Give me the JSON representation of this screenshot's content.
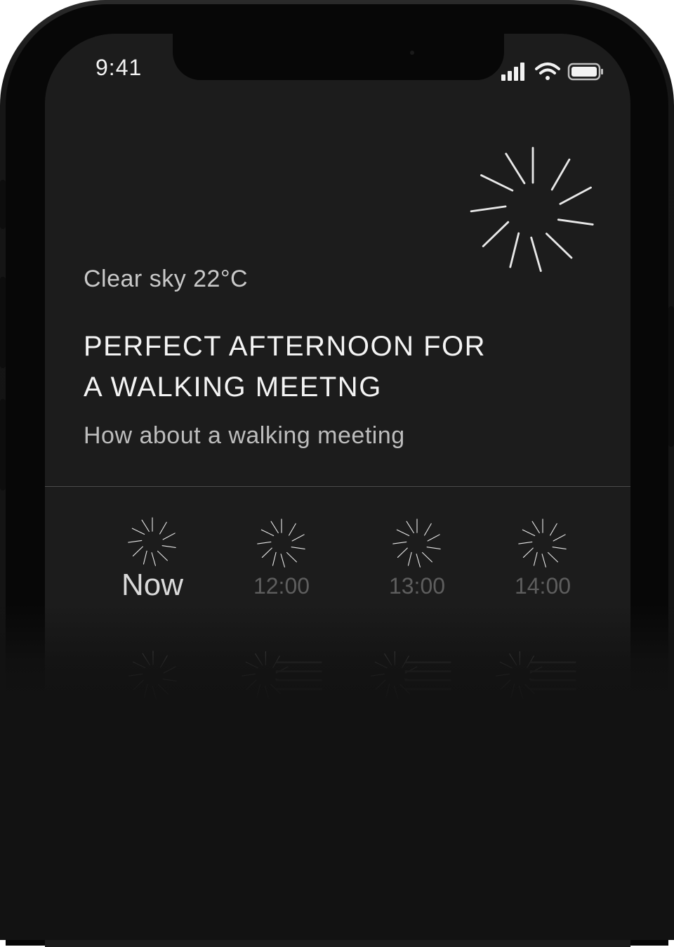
{
  "status_bar": {
    "time": "9:41"
  },
  "weather": {
    "condition": "Clear sky 22°C",
    "headline_line1": "PERFECT AFTERNOON FOR",
    "headline_line2": "A WALKING MEETNG",
    "subtitle": "How about a walking meeting",
    "icon": "clear-sky-sun-icon"
  },
  "forecast": {
    "hours": [
      {
        "label": "Now",
        "icon": "clear-sky-sun-icon"
      },
      {
        "label": "12:00",
        "icon": "clear-sky-sun-icon"
      },
      {
        "label": "13:00",
        "icon": "clear-sky-sun-icon"
      },
      {
        "label": "14:00",
        "icon": "clear-sky-sun-icon"
      }
    ],
    "next_row_icons": [
      "clear-sky-sun-icon",
      "sun-fog-icon",
      "sun-fog-icon",
      "sun-fog-icon"
    ]
  },
  "colors": {
    "background": "#1c1c1c",
    "text_primary": "#f4f4f4",
    "text_secondary": "#c9c9c9",
    "text_muted": "#5e5e5e"
  }
}
